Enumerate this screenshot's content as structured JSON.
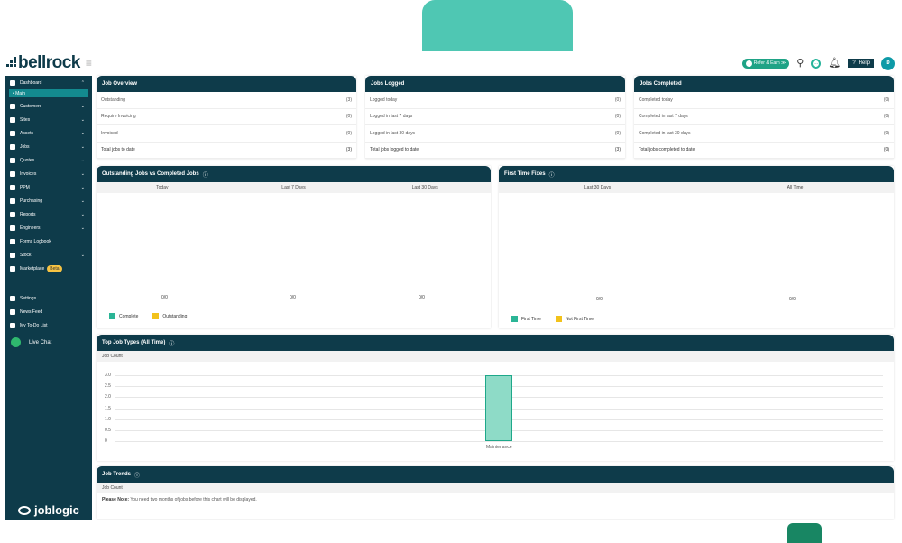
{
  "brand": {
    "name": "bellrock"
  },
  "topbar": {
    "refer": "Refer & Earn ≫",
    "help": "Help",
    "avatar": "D"
  },
  "sidebar": {
    "dashboard": "Dashboard",
    "main": "Main",
    "items": [
      "Customers",
      "Sites",
      "Assets",
      "Jobs",
      "Quotes",
      "Invoices",
      "PPM",
      "Purchasing",
      "Reports",
      "Engineers",
      "Forms Logbook",
      "Stock",
      "Marketplace"
    ],
    "beta": "Beta",
    "lower": [
      "Settings",
      "News Feed",
      "My To-Do List"
    ],
    "live_chat": "Live Chat",
    "footer_logo": "joblogic"
  },
  "job_overview": {
    "title": "Job Overview",
    "rows": [
      {
        "label": "Outstanding",
        "value": "(3)"
      },
      {
        "label": "Require Invoicing",
        "value": "(0)"
      },
      {
        "label": "Invoiced",
        "value": "(0)"
      },
      {
        "label": "Total jobs to date",
        "value": "(3)"
      }
    ]
  },
  "jobs_logged": {
    "title": "Jobs Logged",
    "rows": [
      {
        "label": "Logged today",
        "value": "(0)"
      },
      {
        "label": "Logged in last 7 days",
        "value": "(0)"
      },
      {
        "label": "Logged in last 30 days",
        "value": "(0)"
      },
      {
        "label": "Total jobs logged to date",
        "value": "(3)"
      }
    ]
  },
  "jobs_completed": {
    "title": "Jobs Completed",
    "rows": [
      {
        "label": "Completed today",
        "value": "(0)"
      },
      {
        "label": "Completed in last 7 days",
        "value": "(0)"
      },
      {
        "label": "Completed in last 30 days",
        "value": "(0)"
      },
      {
        "label": "Total jobs completed to date",
        "value": "(0)"
      }
    ]
  },
  "outstanding_vs_completed": {
    "title": "Outstanding Jobs vs Completed Jobs",
    "columns": [
      "Today",
      "Last 7 Days",
      "Last 30 Days"
    ],
    "ratios": [
      "0/0",
      "0/0",
      "0/0"
    ],
    "legend": [
      {
        "label": "Complete",
        "color": "#2bb596"
      },
      {
        "label": "Outstanding",
        "color": "#f2c21b"
      }
    ]
  },
  "first_time_fixes": {
    "title": "First Time Fixes",
    "columns": [
      "Last 30 Days",
      "All Time"
    ],
    "ratios": [
      "0/0",
      "0/0"
    ],
    "legend": [
      {
        "label": "First Time",
        "color": "#2bb596"
      },
      {
        "label": "Not First Time",
        "color": "#f2c21b"
      }
    ]
  },
  "top_job_types": {
    "title": "Top Job Types (All Time)",
    "subheader": "Job Count",
    "chart_data": {
      "type": "bar",
      "categories": [
        "Maintenance"
      ],
      "values": [
        3
      ],
      "ylim": [
        0,
        3
      ],
      "yticks": [
        "3.0",
        "2.5",
        "2.0",
        "1.5",
        "1.0",
        "0.5",
        "0"
      ],
      "ylabel": "Job Count"
    }
  },
  "job_trends": {
    "title": "Job Trends",
    "subheader": "Job Count",
    "note_bold": "Please Note:",
    "note": " You need two months of jobs before this chart will be displayed."
  }
}
